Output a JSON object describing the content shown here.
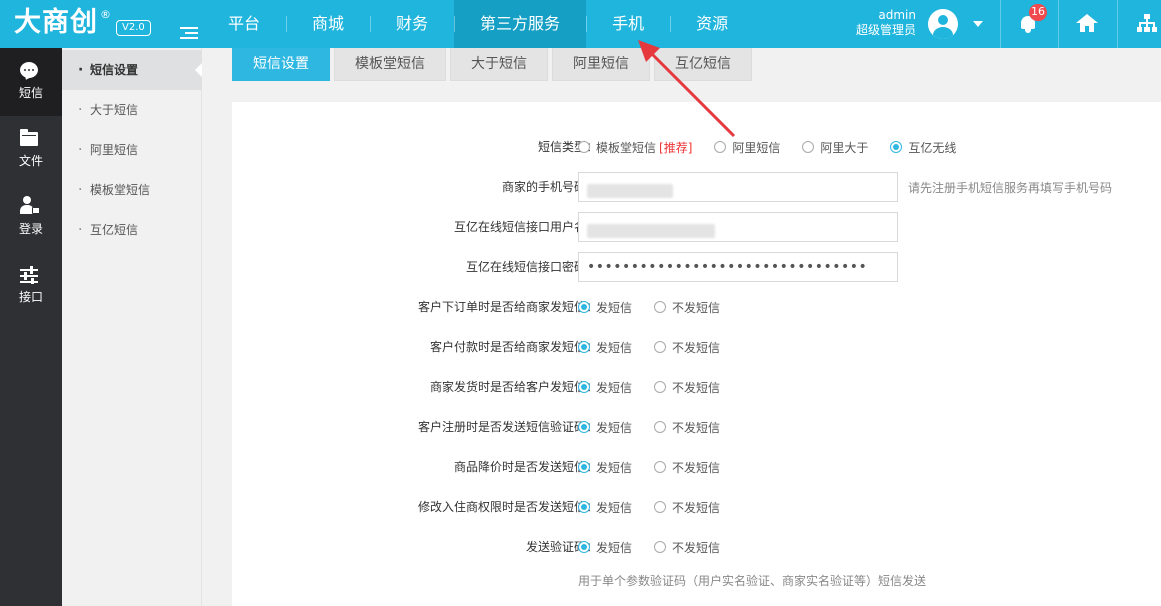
{
  "header": {
    "logo": "大商创",
    "logo_mark": "®",
    "version": "V2.0",
    "nav": [
      {
        "label": "平台",
        "active": false
      },
      {
        "label": "商城",
        "active": false
      },
      {
        "label": "财务",
        "active": false
      },
      {
        "label": "第三方服务",
        "active": true
      },
      {
        "label": "手机",
        "active": false
      },
      {
        "label": "资源",
        "active": false
      }
    ],
    "user_name": "admin",
    "user_role": "超级管理员",
    "notification_count": "16",
    "icons": [
      "menu-toggle-icon",
      "avatar-icon",
      "chevron-down-icon",
      "bell-icon",
      "home-icon",
      "sitemap-icon"
    ],
    "color": "#1fb5dd"
  },
  "iconbar": [
    {
      "label": "短信",
      "icon": "chat-icon",
      "active": true
    },
    {
      "label": "文件",
      "icon": "folder-icon",
      "active": false
    },
    {
      "label": "登录",
      "icon": "user-lock-icon",
      "active": false
    },
    {
      "label": "接口",
      "icon": "sliders-icon",
      "active": false
    }
  ],
  "submenu": [
    {
      "label": "短信设置",
      "active": true
    },
    {
      "label": "大于短信",
      "active": false
    },
    {
      "label": "阿里短信",
      "active": false
    },
    {
      "label": "模板堂短信",
      "active": false
    },
    {
      "label": "互亿短信",
      "active": false
    }
  ],
  "tabs": [
    {
      "label": "短信设置",
      "active": true
    },
    {
      "label": "模板堂短信",
      "active": false
    },
    {
      "label": "大于短信",
      "active": false
    },
    {
      "label": "阿里短信",
      "active": false
    },
    {
      "label": "互亿短信",
      "active": false
    }
  ],
  "form": {
    "sms_type": {
      "label": "短信类型：",
      "options": [
        "模板堂短信",
        "阿里短信",
        "阿里大于",
        "互亿无线"
      ],
      "recommend": "[推荐]",
      "selected": "互亿无线"
    },
    "phone": {
      "label": "商家的手机号码：",
      "hint": "请先注册手机短信服务再填写手机号码"
    },
    "api_user": {
      "label": "互亿在线短信接口用户名："
    },
    "api_password": {
      "label": "互亿在线短信接口密码：",
      "value": "••••••••••••••••••••••••••••••••"
    },
    "send_label": "发短信",
    "no_send_label": "不发短信",
    "toggles": [
      {
        "label": "客户下订单时是否给商家发短信：",
        "selected": "发短信"
      },
      {
        "label": "客户付款时是否给商家发短信：",
        "selected": "发短信"
      },
      {
        "label": "商家发货时是否给客户发短信：",
        "selected": "发短信"
      },
      {
        "label": "客户注册时是否发送短信验证码：",
        "selected": "发短信"
      },
      {
        "label": "商品降价时是否发送短信：",
        "selected": "发短信"
      },
      {
        "label": "修改入住商权限时是否发送短信：",
        "selected": "发短信"
      },
      {
        "label": "发送验证码：",
        "selected": "发短信"
      }
    ],
    "note": "用于单个参数验证码（用户实名验证、商家实名验证等）短信发送"
  },
  "accent_color": "#2db7e1",
  "annotation_arrow_color": "#e6393e"
}
